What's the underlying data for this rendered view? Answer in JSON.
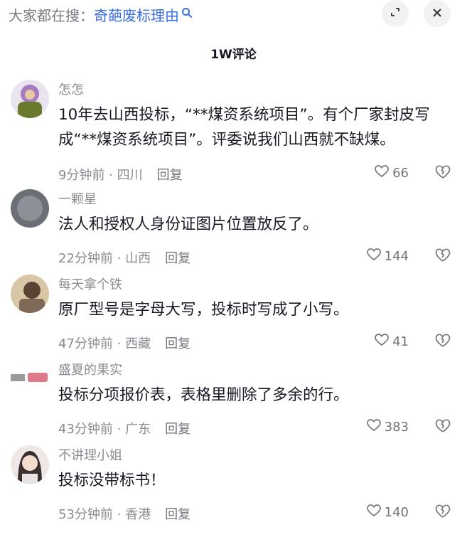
{
  "search_bar": {
    "prefix": "大家都在搜：",
    "query": "奇葩废标理由"
  },
  "header": {
    "title": "1W评论"
  },
  "comments": [
    {
      "author": "怎怎",
      "text": "10年去山西投标，“**煤资系统项目”。有个厂家封皮写成“**煤资系统项目”。评委说我们山西就不缺煤。",
      "time": "9分钟前",
      "location": "四川",
      "reply": "回复",
      "likes": "66"
    },
    {
      "author": "一颗星",
      "text": "法人和授权人身份证图片位置放反了。",
      "time": "22分钟前",
      "location": "山西",
      "reply": "回复",
      "likes": "144"
    },
    {
      "author": "每天拿个铁",
      "text": "原厂型号是字母大写，投标时写成了小写。",
      "time": "47分钟前",
      "location": "西藏",
      "reply": "回复",
      "likes": "41"
    },
    {
      "author": "盛夏的果实",
      "text": "投标分项报价表，表格里删除了多余的行。",
      "time": "43分钟前",
      "location": "广东",
      "reply": "回复",
      "likes": "383"
    },
    {
      "author": "不讲理小姐",
      "text": "投标没带标书！",
      "time": "53分钟前",
      "location": "香港",
      "reply": "回复",
      "likes": "140"
    }
  ],
  "avatars": [
    {
      "caption": ""
    },
    {
      "caption": "一颗星"
    },
    {
      "caption": ""
    },
    {
      "caption": ""
    },
    {
      "caption": ""
    }
  ],
  "icons": {
    "search": "search-icon",
    "expand": "expand-icon",
    "close": "close-icon",
    "like": "heart-icon",
    "dislike": "broken-heart-icon"
  },
  "colors": {
    "link": "#3a6ee0",
    "muted": "#8b8c93",
    "text": "#161823",
    "button_bg": "#f2f2f4"
  }
}
